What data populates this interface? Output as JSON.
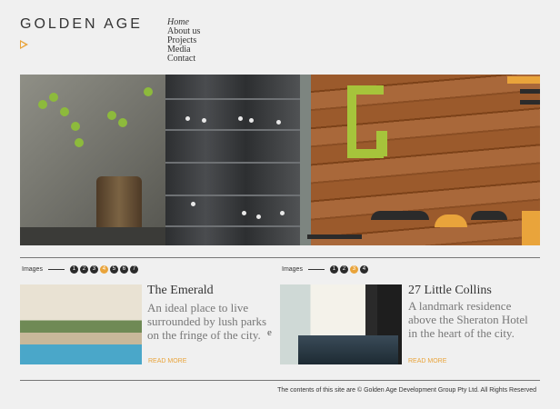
{
  "brand": {
    "logo_text": "GOLDEN AGE",
    "accent": "#e9a43b"
  },
  "nav": {
    "items": [
      {
        "label": "Home",
        "active": true
      },
      {
        "label": "About us"
      },
      {
        "label": "Projects"
      },
      {
        "label": "Media"
      },
      {
        "label": "Contact"
      }
    ]
  },
  "projects": [
    {
      "pager_label": "Images",
      "pages": [
        "1",
        "2",
        "3",
        "4",
        "5",
        "6",
        "7"
      ],
      "active_page": "4",
      "title": "The Emerald",
      "description": "An ideal place to live surrounded by lush parks on the fringe of the city.",
      "read_more": "READ MORE"
    },
    {
      "pager_label": "Images",
      "pages": [
        "1",
        "2",
        "3",
        "4"
      ],
      "active_page": "3",
      "title": "27 Little Collins",
      "description": "A landmark residence above the Sheraton Hotel in the heart of the city.",
      "read_more": "READ MORE"
    }
  ],
  "stray_char": "e",
  "footer": {
    "text": "The contents of this site are © Golden Age Development Group Pty Ltd. All Rights Reserved"
  }
}
